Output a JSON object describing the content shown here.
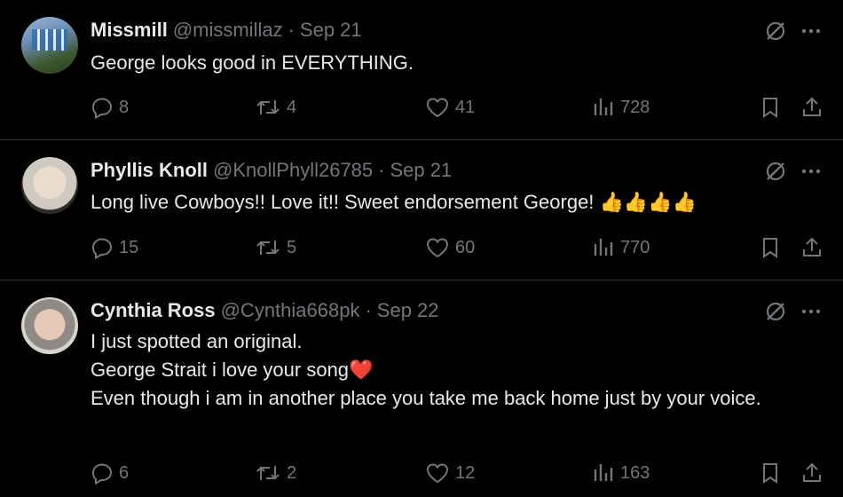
{
  "tweets": [
    {
      "name": "Missmill",
      "handle": "@missmillaz",
      "date": "Sep 21",
      "text": "George looks good in EVERYTHING.",
      "replies": "8",
      "reposts": "4",
      "likes": "41",
      "views": "728",
      "avatar_icon": "stadium-avatar"
    },
    {
      "name": "Phyllis Knoll",
      "handle": "@KnollPhyll26785",
      "date": "Sep 21",
      "text": "Long live Cowboys!!  Love it!! Sweet endorsement George! 👍👍👍👍",
      "replies": "15",
      "reposts": "5",
      "likes": "60",
      "views": "770",
      "avatar_icon": "profile-photo-avatar"
    },
    {
      "name": "Cynthia Ross",
      "handle": "@Cynthia668pk",
      "date": "Sep 22",
      "text": "I just spotted an original.\nGeorge Strait i love your song❤️\nEven though i am in another place you take me back home just by your voice.",
      "replies": "6",
      "reposts": "2",
      "likes": "12",
      "views": "163",
      "avatar_icon": "profile-photo-avatar"
    }
  ],
  "icons": {
    "reply": "reply-icon",
    "repost": "repost-icon",
    "like": "heart-icon",
    "views": "views-icon",
    "bookmark": "bookmark-icon",
    "share": "share-icon",
    "grok": "grok-icon",
    "more": "more-icon"
  },
  "colors": {
    "background": "#000000",
    "primary_text": "#e7e9ea",
    "secondary_text": "#71767b",
    "divider": "#2f3336"
  },
  "separator": "·"
}
